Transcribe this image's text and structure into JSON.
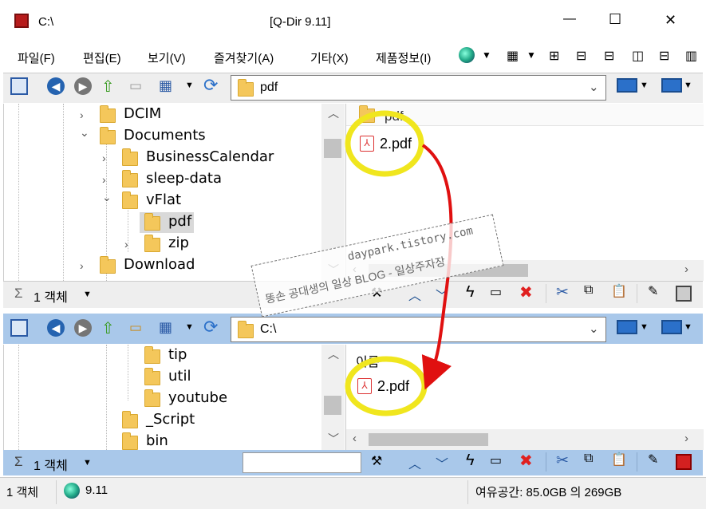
{
  "window": {
    "path_title": "C:\\",
    "app_title": "[Q-Dir 9.11]",
    "controls": {
      "minimize": "—",
      "maximize": "☐",
      "close": "✕"
    }
  },
  "menu": [
    {
      "label": "파일(F)"
    },
    {
      "label": "편집(E)"
    },
    {
      "label": "보기(V)"
    },
    {
      "label": "즐겨찾기(A)"
    },
    {
      "label": "기타(X)"
    },
    {
      "label": "제품정보(I)"
    }
  ],
  "top_pane": {
    "address": "pdf",
    "tree": [
      {
        "label": "DCIM",
        "chevron": "›"
      },
      {
        "label": "Documents",
        "chevron": "⌄"
      },
      {
        "label": "BusinessCalendar",
        "chevron": "›"
      },
      {
        "label": "sleep-data",
        "chevron": "›"
      },
      {
        "label": "vFlat",
        "chevron": "⌄"
      },
      {
        "label": "pdf",
        "chevron": ""
      },
      {
        "label": "zip",
        "chevron": "›"
      },
      {
        "label": "Download",
        "chevron": "›"
      }
    ],
    "files": [
      {
        "name": "pdf"
      },
      {
        "name": "2.pdf"
      }
    ],
    "status": "1 객체"
  },
  "bottom_pane": {
    "address": "C:\\",
    "tree": [
      {
        "label": "tip"
      },
      {
        "label": "util"
      },
      {
        "label": "youtube"
      },
      {
        "label": "_Script"
      },
      {
        "label": "bin"
      }
    ],
    "column_header": "이름",
    "files": [
      {
        "name": "2.pdf"
      }
    ],
    "status": "1 객체"
  },
  "watermark": {
    "line1": "daypark.tistory.com",
    "line2": "똥손 공대생의 일상 BLOG - 일상주자장"
  },
  "statusbar": {
    "count": "1 객체",
    "version": "9.11",
    "free_space": "여유공간: 85.0GB 의 269GB"
  },
  "colors": {
    "bar_blue": "#a9c8ea",
    "highlight_circle": "#f0e61e",
    "arrow": "#e01010"
  }
}
